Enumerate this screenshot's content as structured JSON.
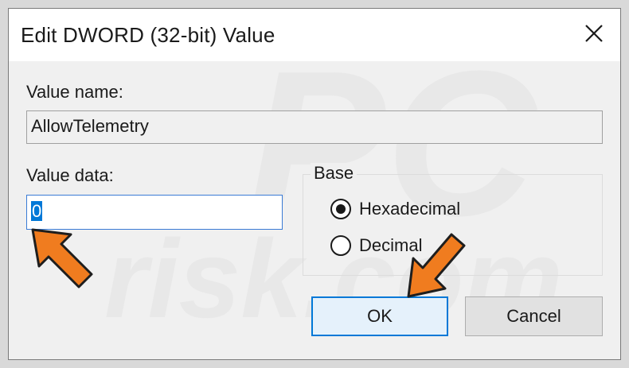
{
  "dialog": {
    "title": "Edit DWORD (32-bit) Value",
    "value_name_label": "Value name:",
    "value_name": "AllowTelemetry",
    "value_data_label": "Value data:",
    "value_data": "0",
    "base_label": "Base",
    "base_options": [
      {
        "label": "Hexadecimal",
        "selected": true
      },
      {
        "label": "Decimal",
        "selected": false
      }
    ],
    "ok_label": "OK",
    "cancel_label": "Cancel",
    "close_icon": "close-icon"
  },
  "watermark": {
    "logo_text": "PC",
    "site_text": "risk.com"
  },
  "annotations": {
    "arrow_color": "#f07c1f",
    "arrow_outline": "#1e1e1e"
  },
  "colors": {
    "selection": "#0078d7",
    "default_button_border": "#0078d7",
    "titlebar": "#ffffff",
    "dialog_bg": "#f0f0f0"
  }
}
